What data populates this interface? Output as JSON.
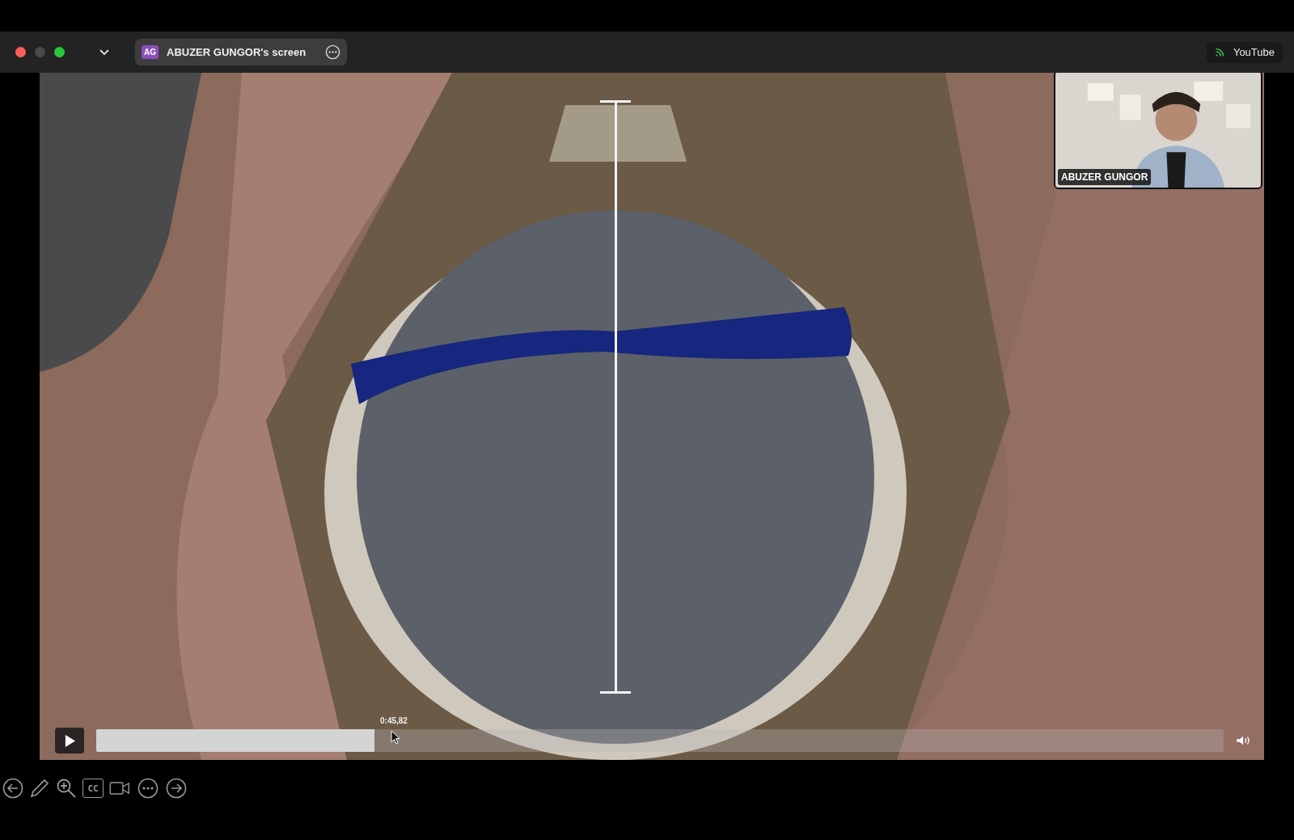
{
  "share_pill": {
    "initials": "AG",
    "title": "ABUZER GUNGOR's screen"
  },
  "app_badge": {
    "label": "YouTube"
  },
  "video": {
    "kind": "picture",
    "player": {
      "playing": false,
      "time": "0:45,82",
      "level": 0.247
    }
  },
  "participant": {
    "kind": "picture",
    "name": "ABUZER GUNGOR"
  },
  "toolbar": {
    "captions_label": "CC"
  }
}
